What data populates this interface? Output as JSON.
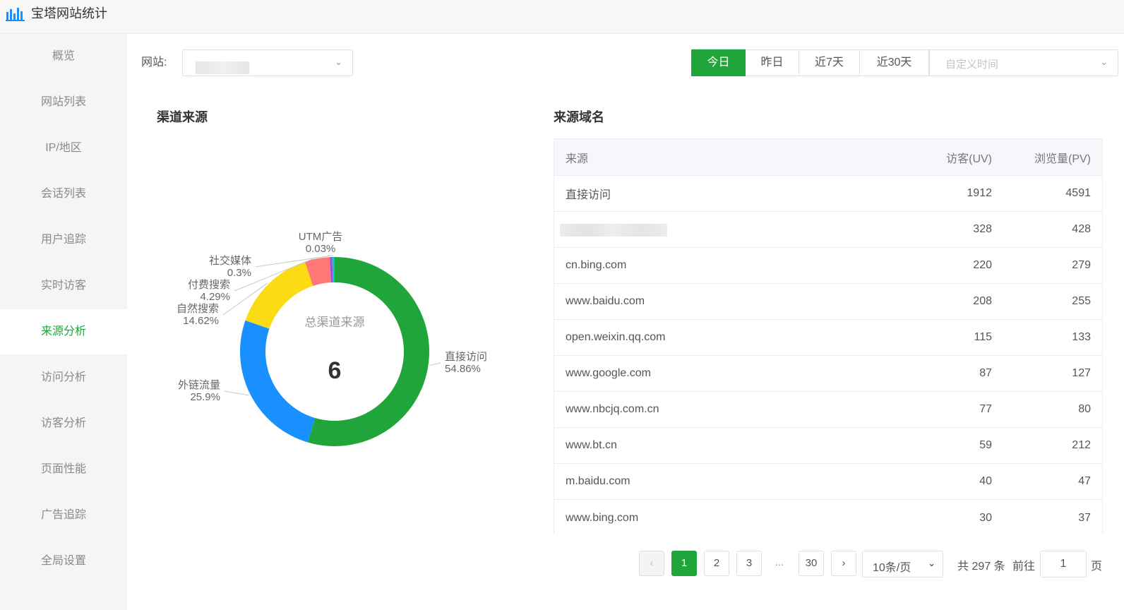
{
  "app": {
    "title": "宝塔网站统计",
    "logo_icon": "bar-chart-icon",
    "accent": "#20a53a"
  },
  "sidebar": {
    "items": [
      {
        "label": "概览"
      },
      {
        "label": "网站列表"
      },
      {
        "label": "IP/地区"
      },
      {
        "label": "会话列表"
      },
      {
        "label": "用户追踪"
      },
      {
        "label": "实时访客"
      },
      {
        "label": "来源分析",
        "active": true
      },
      {
        "label": "访问分析"
      },
      {
        "label": "访客分析"
      },
      {
        "label": "页面性能"
      },
      {
        "label": "广告追踪"
      },
      {
        "label": "全局设置"
      }
    ]
  },
  "filters": {
    "site_label": "网站:",
    "site_value": "",
    "date_buttons": [
      {
        "label": "今日",
        "active": true
      },
      {
        "label": "昨日"
      },
      {
        "label": "近7天"
      },
      {
        "label": "近30天"
      }
    ],
    "custom_placeholder": "自定义时间"
  },
  "channel": {
    "title": "渠道来源",
    "center_label": "总渠道来源",
    "center_value": "6"
  },
  "chart_data": {
    "type": "pie",
    "donut": true,
    "title": "渠道来源",
    "center_label": "总渠道来源",
    "center_value": "6",
    "series": [
      {
        "name": "直接访问",
        "pct": "54.86%",
        "value": 54.86,
        "color": "#20a53a"
      },
      {
        "name": "外链流量",
        "pct": "25.9%",
        "value": 25.9,
        "color": "#1890ff"
      },
      {
        "name": "自然搜索",
        "pct": "14.62%",
        "value": 14.62,
        "color": "#fadb14"
      },
      {
        "name": "付费搜索",
        "pct": "4.29%",
        "value": 4.29,
        "color": "#ff7875"
      },
      {
        "name": "社交媒体",
        "pct": "0.3%",
        "value": 0.3,
        "color": "#9254de"
      },
      {
        "name": "UTM广告",
        "pct": "0.03%",
        "value": 0.03,
        "color": "#13c2c2"
      }
    ]
  },
  "domains": {
    "title": "来源域名",
    "columns": {
      "source": "来源",
      "uv": "访客(UV)",
      "pv": "浏览量(PV)"
    },
    "rows": [
      {
        "source": "直接访问",
        "uv": "1912",
        "pv": "4591"
      },
      {
        "source": "",
        "uv": "328",
        "pv": "428",
        "redacted": true
      },
      {
        "source": "cn.bing.com",
        "uv": "220",
        "pv": "279"
      },
      {
        "source": "www.baidu.com",
        "uv": "208",
        "pv": "255"
      },
      {
        "source": "open.weixin.qq.com",
        "uv": "115",
        "pv": "133"
      },
      {
        "source": "www.google.com",
        "uv": "87",
        "pv": "127"
      },
      {
        "source": "www.nbcjq.com.cn",
        "uv": "77",
        "pv": "80"
      },
      {
        "source": "www.bt.cn",
        "uv": "59",
        "pv": "212"
      },
      {
        "source": "m.baidu.com",
        "uv": "40",
        "pv": "47"
      },
      {
        "source": "www.bing.com",
        "uv": "30",
        "pv": "37"
      }
    ]
  },
  "pagination": {
    "prev": "‹",
    "next": "›",
    "pages": [
      "1",
      "2",
      "3"
    ],
    "ellipsis": "...",
    "last": "30",
    "current": "1",
    "page_size": "10条/页",
    "total": "共 297 条",
    "goto_label": "前往",
    "goto_value": "1",
    "page_unit": "页"
  }
}
